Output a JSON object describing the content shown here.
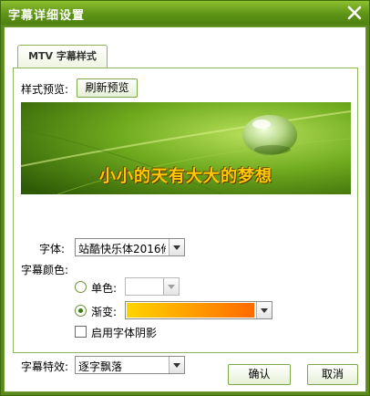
{
  "window": {
    "title": "字幕详细设置"
  },
  "tabs": [
    {
      "label": "MTV 字幕样式"
    }
  ],
  "preview": {
    "label": "样式预览:",
    "refresh_button": "刷新预览",
    "sample_text": "小小的天有大大的梦想"
  },
  "font": {
    "label": "字体:",
    "value": "站酷快乐体2016修"
  },
  "color": {
    "label": "字幕颜色:",
    "solid_label": "单色:",
    "solid_selected": false,
    "gradient_label": "渐变:",
    "gradient_selected": true,
    "gradient_start_color": "#ffd400",
    "gradient_end_color": "#ff6a00",
    "shadow_label": "启用字体阴影",
    "shadow_checked": false
  },
  "effect": {
    "label": "字幕特效:",
    "value": "逐字飘落"
  },
  "buttons": {
    "ok": "确认",
    "cancel": "取消"
  }
}
